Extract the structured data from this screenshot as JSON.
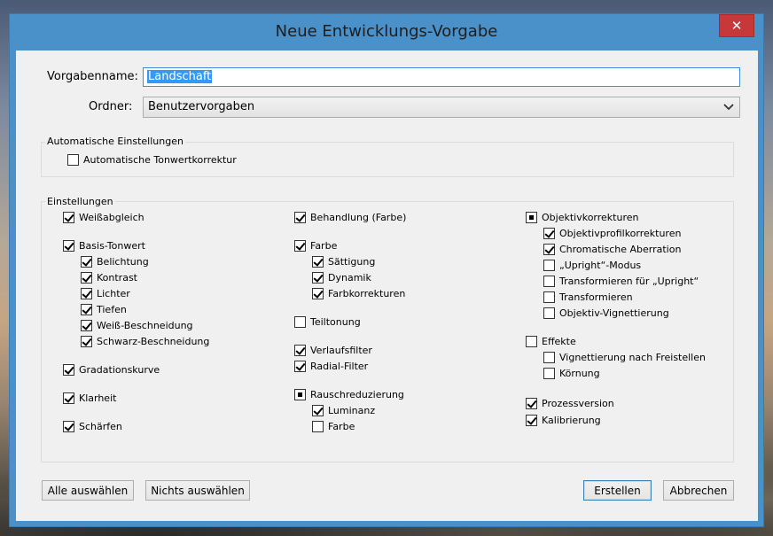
{
  "dialog": {
    "title": "Neue Entwicklungs-Vorgabe",
    "close_glyph": "✕"
  },
  "preset": {
    "name_label": "Vorgabenname:",
    "name_value": "Landschaft",
    "folder_label": "Ordner:",
    "folder_value": "Benutzervorgaben"
  },
  "auto": {
    "group_title": "Automatische Einstellungen",
    "label": "Automatische Tonwertkorrektur",
    "state": "unchecked"
  },
  "settings": {
    "group_title": "Einstellungen",
    "col1": [
      {
        "label": "Weißabgleich",
        "state": "checked"
      },
      {
        "label": "Basis-Tonwert",
        "state": "checked"
      },
      {
        "label": "Belichtung",
        "state": "checked"
      },
      {
        "label": "Kontrast",
        "state": "checked"
      },
      {
        "label": "Lichter",
        "state": "checked"
      },
      {
        "label": "Tiefen",
        "state": "checked"
      },
      {
        "label": "Weiß-Beschneidung",
        "state": "checked"
      },
      {
        "label": "Schwarz-Beschneidung",
        "state": "checked"
      },
      {
        "label": "Gradationskurve",
        "state": "checked"
      },
      {
        "label": "Klarheit",
        "state": "checked"
      },
      {
        "label": "Schärfen",
        "state": "checked"
      }
    ],
    "col2": [
      {
        "label": "Behandlung (Farbe)",
        "state": "checked"
      },
      {
        "label": "Farbe",
        "state": "checked"
      },
      {
        "label": "Sättigung",
        "state": "checked"
      },
      {
        "label": "Dynamik",
        "state": "checked"
      },
      {
        "label": "Farbkorrekturen",
        "state": "checked"
      },
      {
        "label": "Teiltonung",
        "state": "unchecked"
      },
      {
        "label": "Verlaufsfilter",
        "state": "checked"
      },
      {
        "label": "Radial-Filter",
        "state": "checked"
      },
      {
        "label": "Rauschreduzierung",
        "state": "mixed"
      },
      {
        "label": "Luminanz",
        "state": "checked"
      },
      {
        "label": "Farbe",
        "state": "unchecked"
      }
    ],
    "col3": [
      {
        "label": "Objektivkorrekturen",
        "state": "mixed"
      },
      {
        "label": "Objektivprofilkorrekturen",
        "state": "checked"
      },
      {
        "label": "Chromatische Aberration",
        "state": "checked"
      },
      {
        "label": "„Upright“-Modus",
        "state": "unchecked"
      },
      {
        "label": "Transformieren für „Upright“",
        "state": "unchecked"
      },
      {
        "label": "Transformieren",
        "state": "unchecked"
      },
      {
        "label": "Objektiv-Vignettierung",
        "state": "unchecked"
      },
      {
        "label": "Effekte",
        "state": "unchecked"
      },
      {
        "label": "Vignettierung nach Freistellen",
        "state": "unchecked"
      },
      {
        "label": "Körnung",
        "state": "unchecked"
      },
      {
        "label": "Prozessversion",
        "state": "checked"
      },
      {
        "label": "Kalibrierung",
        "state": "checked"
      }
    ]
  },
  "buttons": {
    "select_all": "Alle auswählen",
    "select_none": "Nichts auswählen",
    "create": "Erstellen",
    "cancel": "Abbrechen"
  },
  "colors": {
    "title_bar": "#4a90c9",
    "close_button": "#c7383a",
    "selection": "#3399ff"
  }
}
